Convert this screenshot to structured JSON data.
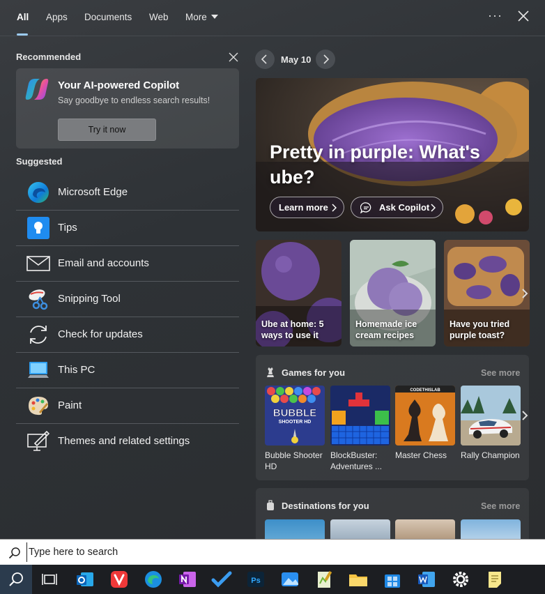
{
  "tabs": {
    "all": "All",
    "apps": "Apps",
    "documents": "Documents",
    "web": "Web",
    "more": "More"
  },
  "header": {
    "options_label": "···"
  },
  "recommended": {
    "heading": "Recommended",
    "copilot_title": "Your AI-powered Copilot",
    "copilot_subtitle": "Say goodbye to endless search results!",
    "try_button": "Try it now"
  },
  "suggested": {
    "heading": "Suggested",
    "items": [
      {
        "label": "Microsoft Edge",
        "icon": "edge-icon"
      },
      {
        "label": "Tips",
        "icon": "tips-icon"
      },
      {
        "label": "Email and accounts",
        "icon": "mail-icon"
      },
      {
        "label": "Snipping Tool",
        "icon": "snipping-tool-icon"
      },
      {
        "label": "Check for updates",
        "icon": "update-icon"
      },
      {
        "label": "This PC",
        "icon": "this-pc-icon"
      },
      {
        "label": "Paint",
        "icon": "paint-icon"
      },
      {
        "label": "Themes and related settings",
        "icon": "themes-icon"
      }
    ]
  },
  "highlights": {
    "date": "May 10",
    "hero_title": "Pretty in purple: What's ube?",
    "learn_more": "Learn more",
    "ask_copilot": "Ask Copilot",
    "tiles": [
      {
        "caption": "Ube at home: 5 ways to use it"
      },
      {
        "caption": "Homemade ice cream recipes"
      },
      {
        "caption": "Have you tried purple toast?"
      }
    ]
  },
  "games": {
    "title": "Games for you",
    "see_more": "See more",
    "items": [
      {
        "name": "Bubble Shooter HD",
        "art_text_1": "BUBBLE",
        "art_text_2": "SHOOTER HD"
      },
      {
        "name": "BlockBuster: Adventures ..."
      },
      {
        "name": "Master Chess",
        "art_text_1": "CODETHISLAB"
      },
      {
        "name": "Rally Champion"
      }
    ]
  },
  "destinations": {
    "title": "Destinations for you",
    "see_more": "See more"
  },
  "search": {
    "placeholder": "Type here to search"
  },
  "taskbar": {
    "apps": [
      "start-search-icon",
      "task-view-icon",
      "outlook-icon",
      "vivaldi-icon",
      "edge-icon",
      "onenote-icon",
      "todo-icon",
      "photoshop-icon",
      "photos-icon",
      "notepad-plus-icon",
      "file-explorer-icon",
      "store-icon",
      "word-icon",
      "settings-icon",
      "sticky-notes-icon"
    ]
  },
  "colors": {
    "accent": "#9ccbf1",
    "purple": "#6f4aa0",
    "panel": "#2e3236"
  }
}
